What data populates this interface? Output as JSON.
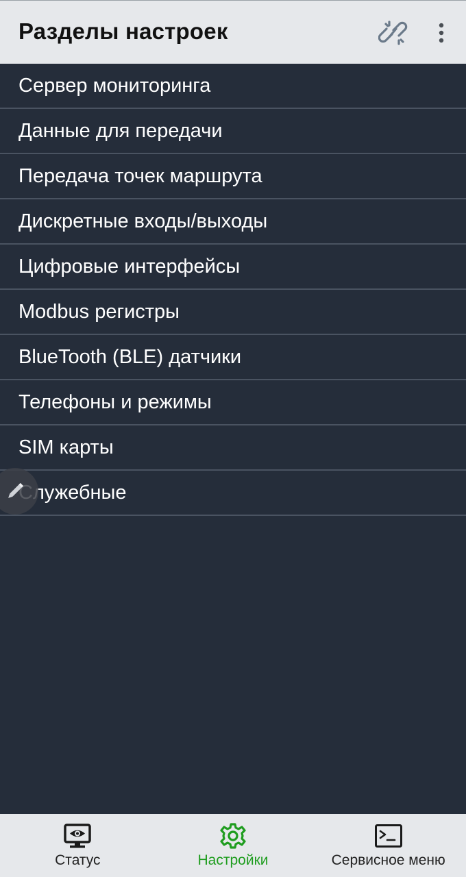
{
  "app_bar": {
    "title": "Разделы настроек",
    "link_icon": "link-off-icon",
    "menu_icon": "more-vert-icon"
  },
  "sections": [
    {
      "label": "Сервер мониторинга"
    },
    {
      "label": "Данные для передачи"
    },
    {
      "label": "Передача точек маршрута"
    },
    {
      "label": "Дискретные входы/выходы"
    },
    {
      "label": "Цифровые интерфейсы"
    },
    {
      "label": "Modbus регистры"
    },
    {
      "label": "BlueTooth (BLE) датчики"
    },
    {
      "label": "Телефоны и режимы"
    },
    {
      "label": "SIM карты"
    },
    {
      "label": "Служебные"
    }
  ],
  "fab": {
    "icon": "pencil-icon"
  },
  "bottom_nav": {
    "items": [
      {
        "label": "Статус",
        "icon": "monitor-eye-icon",
        "active": false
      },
      {
        "label": "Настройки",
        "icon": "gear-icon",
        "active": true
      },
      {
        "label": "Сервисное меню",
        "icon": "terminal-icon",
        "active": false
      }
    ]
  },
  "colors": {
    "background": "#252d3a",
    "bars": "#e6e8eb",
    "accent": "#1f9d1f",
    "divider": "#4a5361"
  }
}
